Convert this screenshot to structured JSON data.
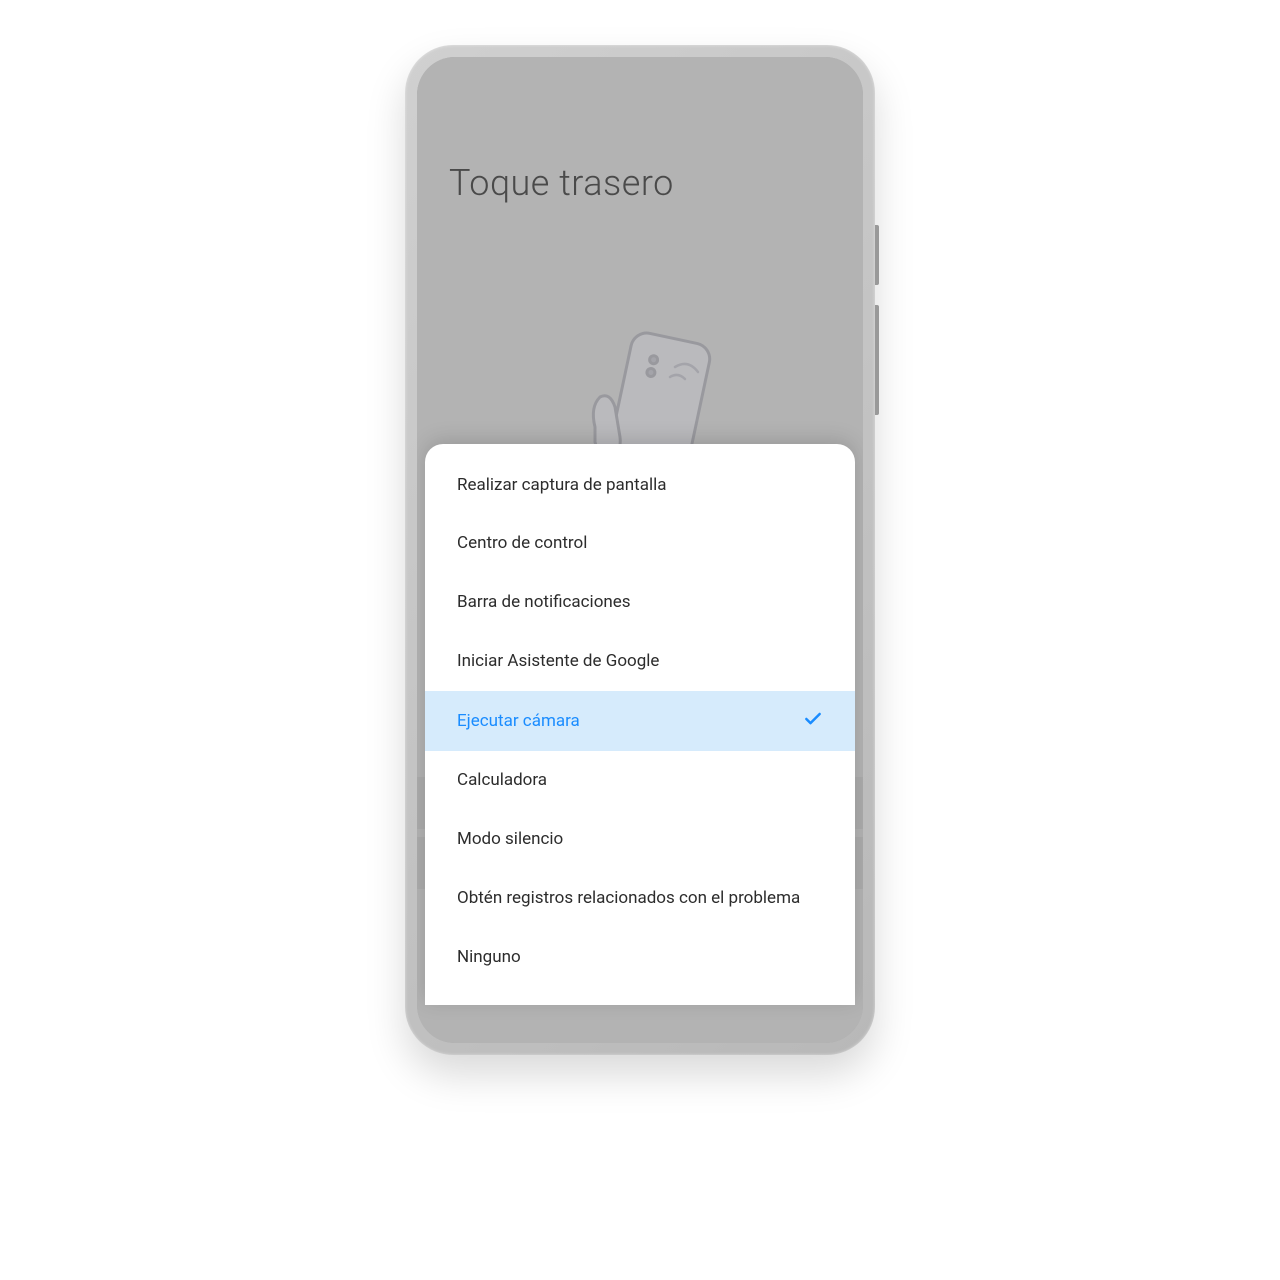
{
  "header": {
    "title": "Toque trasero"
  },
  "modal": {
    "options": [
      {
        "label": "Realizar captura de pantalla",
        "selected": false
      },
      {
        "label": "Centro de control",
        "selected": false
      },
      {
        "label": "Barra de notificaciones",
        "selected": false
      },
      {
        "label": "Iniciar Asistente de Google",
        "selected": false
      },
      {
        "label": "Ejecutar cámara",
        "selected": true
      },
      {
        "label": "Calculadora",
        "selected": false
      },
      {
        "label": "Modo silencio",
        "selected": false
      },
      {
        "label": "Obtén registros relacionados con el problema",
        "selected": false
      },
      {
        "label": "Ninguno",
        "selected": false
      }
    ]
  },
  "colors": {
    "accent": "#1a8cff",
    "selected_bg": "#d6ebfc",
    "page_bg": "#b3b3b3"
  }
}
